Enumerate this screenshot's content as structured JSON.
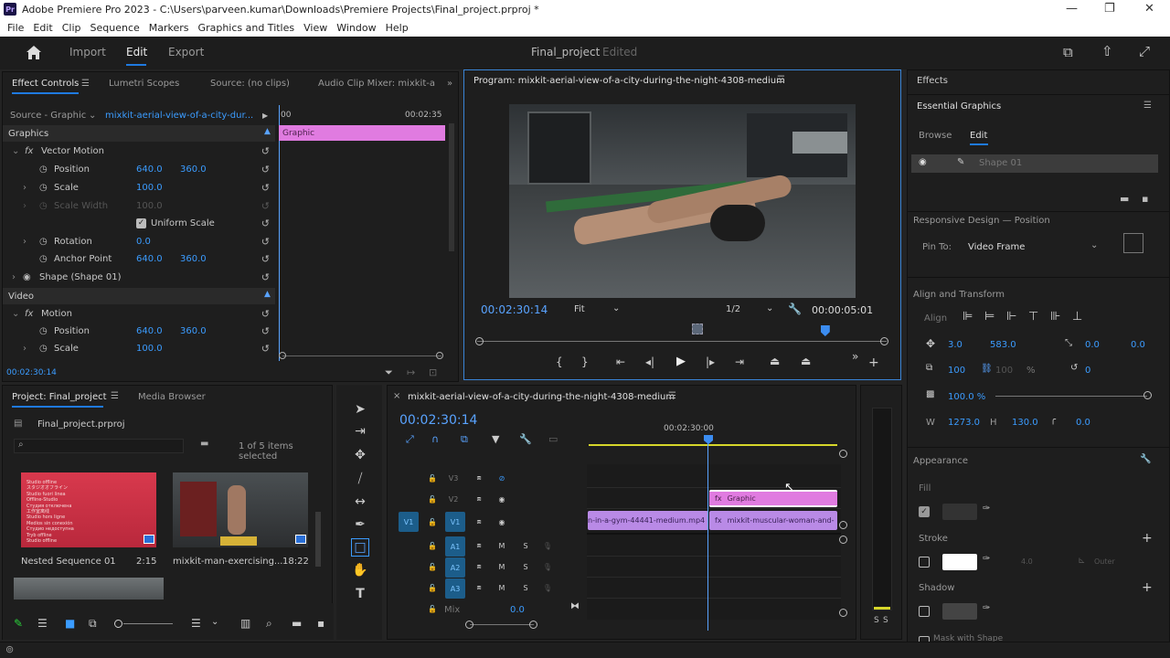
{
  "titlebar": {
    "app_icon": "Pr",
    "title": "Adobe Premiere Pro 2023 - C:\\Users\\parveen.kumar\\Downloads\\Premiere Projects\\Final_project.prproj *"
  },
  "menu": [
    "File",
    "Edit",
    "Clip",
    "Sequence",
    "Markers",
    "Graphics and Titles",
    "View",
    "Window",
    "Help"
  ],
  "header": {
    "tabs": [
      "Import",
      "Edit",
      "Export"
    ],
    "active_tab": "Edit",
    "project_name": "Final_project",
    "status": "Edited"
  },
  "effect_controls": {
    "tabs": [
      "Effect Controls",
      "Lumetri Scopes",
      "Source: (no clips)",
      "Audio Clip Mixer: mixkit-a"
    ],
    "source_label": "Source - Graphic",
    "clip_name": "mixkit-aerial-view-of-a-city-dur...",
    "time_start": "00",
    "time_end": "00:02:35",
    "clip_bar": "Graphic",
    "sections": {
      "graphics": "Graphics",
      "video": "Video"
    },
    "vector_motion": "Vector Motion",
    "position": {
      "label": "Position",
      "x": "640.0",
      "y": "360.0"
    },
    "scale": {
      "label": "Scale",
      "value": "100.0"
    },
    "scale_width": {
      "label": "Scale Width",
      "value": "100.0"
    },
    "uniform_scale": "Uniform Scale",
    "rotation": {
      "label": "Rotation",
      "value": "0.0"
    },
    "anchor": {
      "label": "Anchor Point",
      "x": "640.0",
      "y": "360.0"
    },
    "shape": "Shape (Shape 01)",
    "motion": "Motion",
    "v_position": {
      "label": "Position",
      "x": "640.0",
      "y": "360.0"
    },
    "v_scale": {
      "label": "Scale",
      "value": "100.0"
    },
    "timecode": "00:02:30:14"
  },
  "program": {
    "title": "Program: mixkit-aerial-view-of-a-city-during-the-night-4308-medium",
    "timecode": "00:02:30:14",
    "fit": "Fit",
    "quality": "1/2",
    "duration": "00:00:05:01",
    "playhead_frac": 0.98
  },
  "effects": {
    "title": "Effects",
    "eg_title": "Essential Graphics",
    "tabs": [
      "Browse",
      "Edit"
    ],
    "layer": "Shape 01",
    "responsive": "Responsive Design — Position",
    "pin_to_label": "Pin To:",
    "pin_to": "Video Frame",
    "align_title": "Align and Transform",
    "align_label": "Align",
    "pos_x": "3.0",
    "pos_y": "583.0",
    "anchor_x": "0.0",
    "anchor_y": "0.0",
    "scale": "100",
    "scale_2": "100",
    "pct": "%",
    "rotation": "0",
    "opacity": "100.0 %",
    "w_label": "W",
    "w": "1273.0",
    "h_label": "H",
    "h": "130.0",
    "radius": "0.0",
    "appearance": "Appearance",
    "fill": "Fill",
    "stroke": "Stroke",
    "stroke_width": "4.0",
    "stroke_option": "Outer",
    "shadow": "Shadow",
    "mask": "Mask with Shape"
  },
  "project": {
    "tabs": [
      "Project: Final_project",
      "Media Browser"
    ],
    "file": "Final_project.prproj",
    "selection": "1 of 5 items selected",
    "items": [
      {
        "name": "Nested Sequence 01",
        "duration": "2:15",
        "thumb_lines": [
          "Studio offline",
          "スタジオオフライン",
          "Studio fuori linea",
          "Offline-Studio",
          "Студия отключена",
          "工作室离线",
          "Studio hors ligne",
          "Medios sin conexión",
          "Студио недоступна",
          "Tryb offline",
          "Studio offline"
        ]
      },
      {
        "name": "mixkit-man-exercising...",
        "duration": "18:22"
      }
    ]
  },
  "timeline": {
    "title": "mixkit-aerial-view-of-a-city-during-the-night-4308-medium",
    "timecode": "00:02:30:14",
    "ruler_time": "00:02:30:00",
    "tracks_v": [
      "V3",
      "V2",
      "V1"
    ],
    "source_v": "V1",
    "tracks_a": [
      "A1",
      "A2",
      "A3"
    ],
    "mute": "M",
    "solo": "S",
    "mix_label": "Mix",
    "mix_value": "0.0",
    "clips": {
      "graphic": "Graphic",
      "v1_left": "n-in-a-gym-44441-medium.mp4",
      "v1_right": "mixkit-muscular-woman-and-"
    }
  },
  "meters": {
    "labels": [
      "S",
      "S"
    ]
  },
  "colors": {
    "accent": "#1f7ae0",
    "graphic_clip": "#e07be0",
    "video_clip": "#b98ae6",
    "value_blue": "#3b9cff",
    "playhead": "#59a3ff"
  }
}
